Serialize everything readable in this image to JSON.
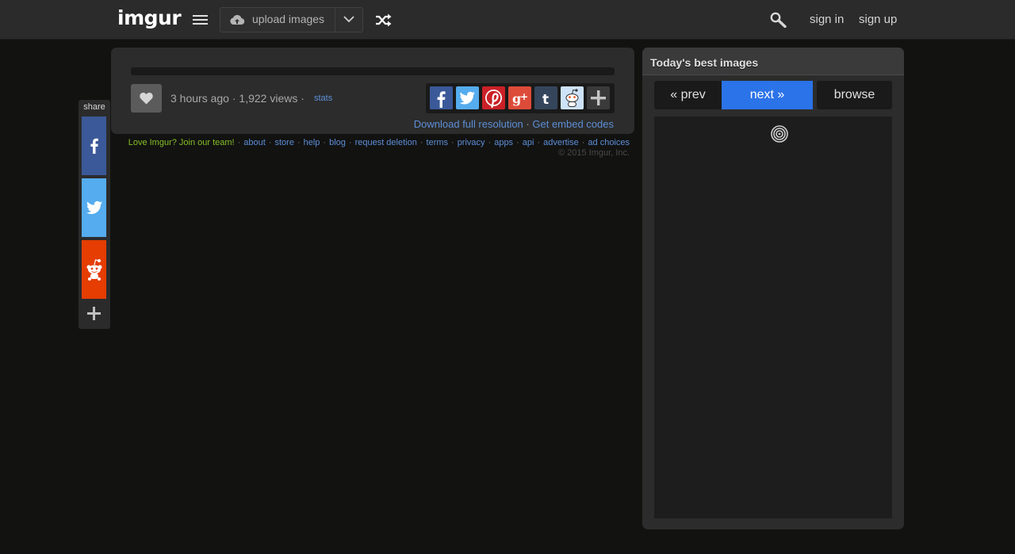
{
  "header": {
    "logo": "imgur",
    "upload_label": "upload images",
    "sign_in": "sign in",
    "sign_up": "sign up"
  },
  "share": {
    "label": "share"
  },
  "post": {
    "time": "3 hours ago",
    "views": "1,922 views",
    "stats_label": "stats",
    "download_label": "Download full resolution",
    "embed_label": "Get embed codes"
  },
  "footer": {
    "team": "Love Imgur? Join our team!",
    "links": [
      "about",
      "store",
      "help",
      "blog",
      "request deletion",
      "terms",
      "privacy",
      "apps",
      "api",
      "advertise",
      "ad choices"
    ],
    "copyright": "© 2015 Imgur, Inc."
  },
  "gallery": {
    "title": "Today's best images",
    "prev": "« prev",
    "next": "next »",
    "browse": "browse"
  },
  "colors": {
    "accent": "#2b73e8",
    "brand_green": "#85bf25",
    "link": "#5d8ed6",
    "facebook": "#3b5998",
    "twitter": "#55acee",
    "reddit": "#e53d02"
  },
  "icons": [
    "menu-icon",
    "cloud-upload-icon",
    "chevron-down-icon",
    "shuffle-icon",
    "search-icon",
    "facebook-icon",
    "twitter-icon",
    "reddit-icon",
    "plus-icon",
    "heart-icon",
    "pinterest-icon",
    "google-plus-icon",
    "tumblr-icon",
    "spinner-icon"
  ]
}
